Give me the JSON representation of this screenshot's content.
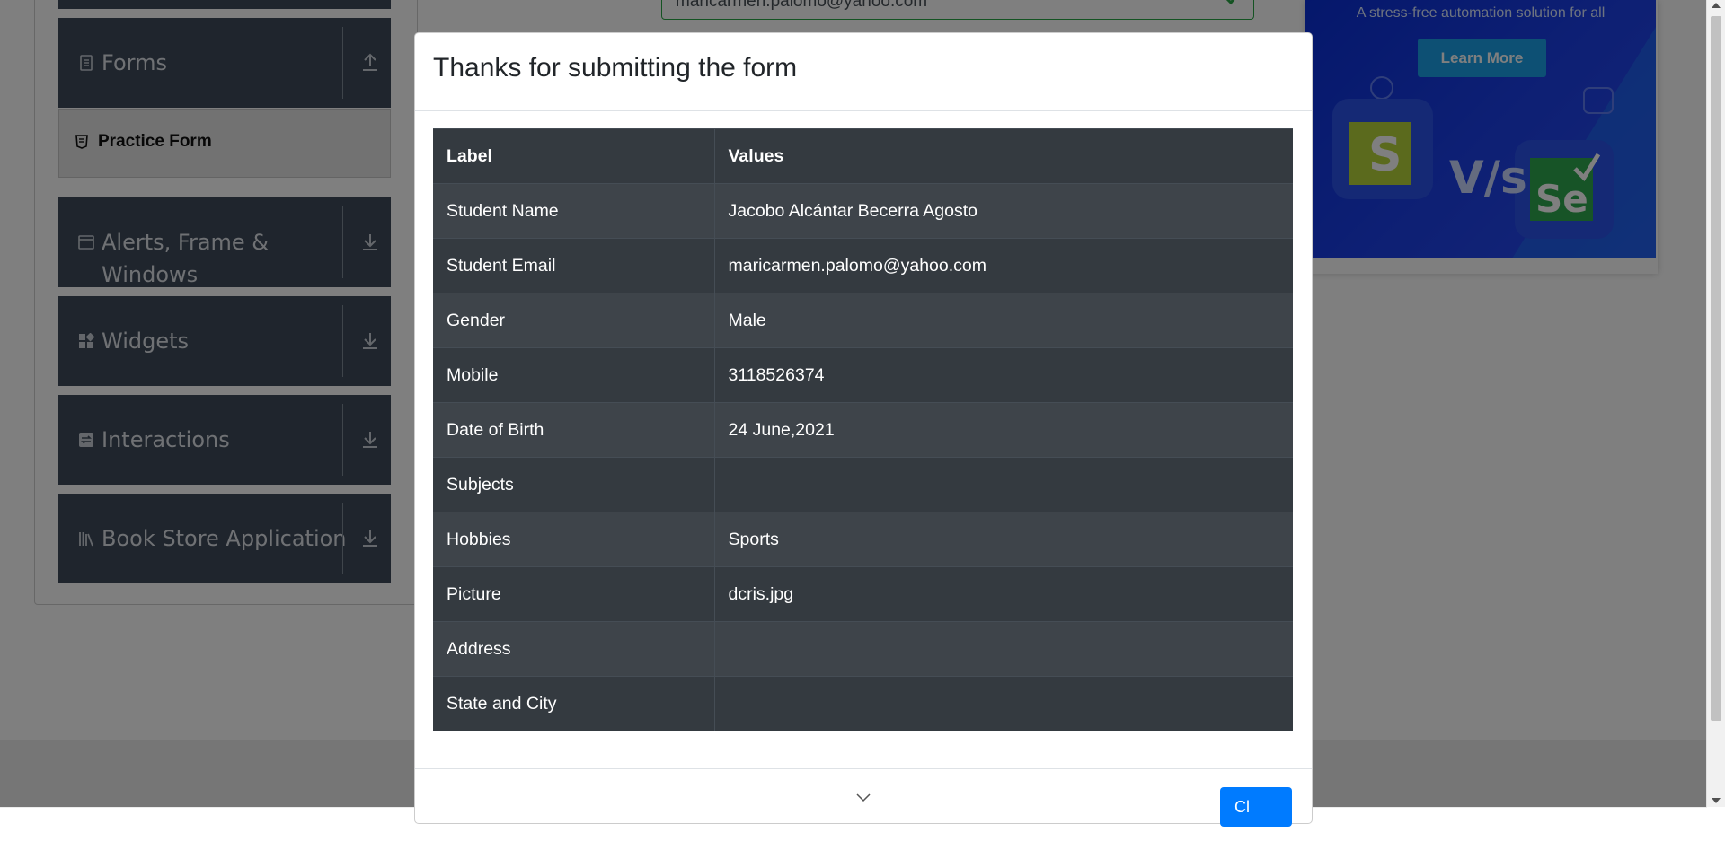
{
  "sidebar": {
    "forms_label": "Forms",
    "practice_form_label": "Practice Form",
    "alerts_label_line1": "Alerts, Frame &",
    "alerts_label_line2": "Windows",
    "widgets_label": "Widgets",
    "interactions_label": "Interactions",
    "bookstore_label": "Book Store Application"
  },
  "form": {
    "email_value": "maricarmen.palomo@yahoo.com"
  },
  "ad": {
    "slogan": "A stress-free automation solution for all",
    "learn_more": "Learn More",
    "vs_text": "V/s",
    "s_logo": "S",
    "se_logo": "Se"
  },
  "modal": {
    "title": "Thanks for submitting the form",
    "header_label": "Label",
    "header_values": "Values",
    "rows": [
      {
        "label": "Student Name",
        "value": "Jacobo Alcántar Becerra Agosto"
      },
      {
        "label": "Student Email",
        "value": "maricarmen.palomo@yahoo.com"
      },
      {
        "label": "Gender",
        "value": "Male"
      },
      {
        "label": "Mobile",
        "value": "3118526374"
      },
      {
        "label": "Date of Birth",
        "value": "24 June,2021"
      },
      {
        "label": "Subjects",
        "value": ""
      },
      {
        "label": "Hobbies",
        "value": "Sports"
      },
      {
        "label": "Picture",
        "value": "dcris.jpg"
      },
      {
        "label": "Address",
        "value": ""
      },
      {
        "label": "State and City",
        "value": ""
      }
    ],
    "close_label": "Close",
    "close_visible": "Cl"
  },
  "colors": {
    "sidebar_group": "#3f4b5a",
    "table_dark": "#343a40",
    "table_stripe": "#3e444a",
    "primary": "#007bff",
    "success": "#28a745"
  },
  "icons": [
    "forms-icon",
    "upload-arrow-icon",
    "practice-form-icon",
    "window-icon",
    "download-arrow-icon",
    "widgets-icon",
    "interactions-icon",
    "bookstore-icon",
    "check-icon",
    "chevron-down-icon"
  ]
}
